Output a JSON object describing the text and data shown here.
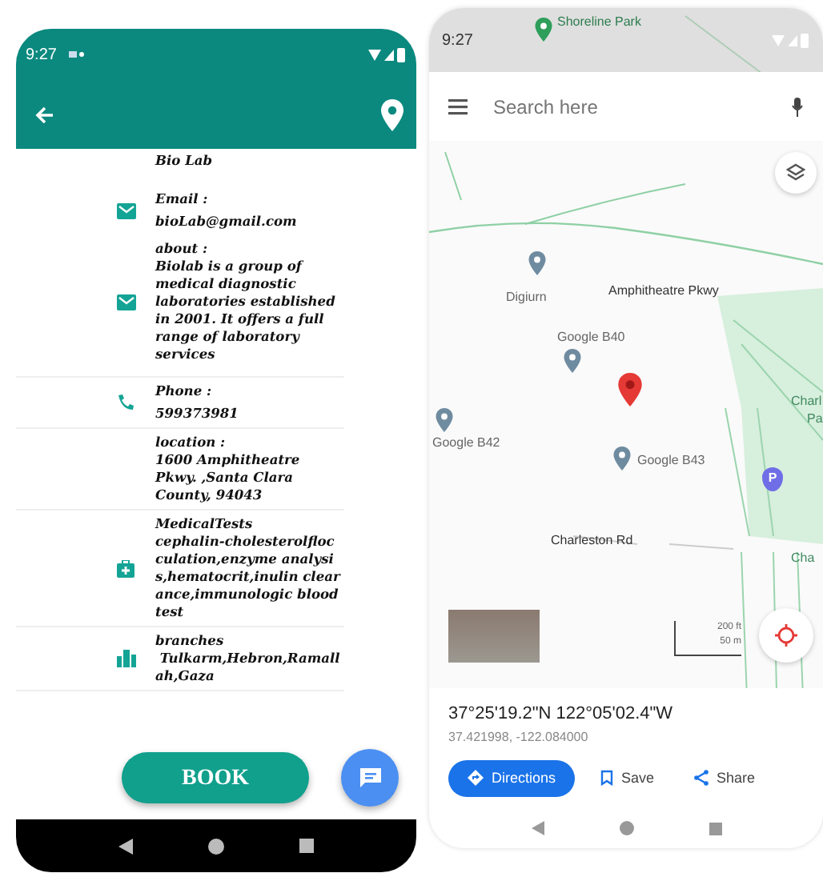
{
  "lab_app": {
    "status_time": "9:27",
    "rows": [
      {
        "kind": "name",
        "label": "Bio Lab"
      },
      {
        "kind": "email",
        "label": "Email :",
        "value": "bioLab@gmail.com"
      },
      {
        "kind": "about",
        "label": "about :",
        "value": "Biolab is a group of medical diagnostic laboratories established in 2001. It offers a full range of laboratory services"
      },
      {
        "kind": "phone",
        "label": "Phone :",
        "value": "599373981"
      },
      {
        "kind": "location",
        "label": "location :",
        "value": "1600 Amphitheatre Pkwy. ,Santa Clara County, 94043"
      },
      {
        "kind": "tests",
        "label": "MedicalTests",
        "value": "cephalin-cholesterolflocculation,enzyme analysis,hematocrit,inulin clearance,immunologic blood test"
      },
      {
        "kind": "branches",
        "label": "branches",
        "value": " Tulkarm,Hebron,Ramallah,Gaza"
      }
    ],
    "book_button": "BOOK"
  },
  "maps_app": {
    "status_time": "9:27",
    "search": {
      "placeholder": "Search here"
    },
    "places": [
      {
        "kind": "park-pin",
        "label": "Shoreline Park"
      },
      {
        "kind": "pin",
        "label": "Digiurn"
      },
      {
        "kind": "road",
        "label": "Amphitheatre Pkwy"
      },
      {
        "kind": "pin",
        "label": "Google B40"
      },
      {
        "kind": "selected-pin"
      },
      {
        "kind": "pin",
        "label": "Google B42"
      },
      {
        "kind": "pin",
        "label": "Google B43"
      },
      {
        "kind": "parking",
        "label": "P"
      },
      {
        "kind": "park-label",
        "label": "Charl"
      },
      {
        "kind": "park-label",
        "label": "Pa"
      },
      {
        "kind": "road",
        "label": "Charleston Rd"
      },
      {
        "kind": "park-label",
        "label": "Cha"
      }
    ],
    "scale": [
      "200 ft",
      "50 m"
    ],
    "coordinates": "37°25'19.2\"N 122°05'02.4\"W",
    "decimal": "37.421998, -122.084000",
    "actions": [
      {
        "kind": "directions",
        "label": "Directions"
      },
      {
        "kind": "save",
        "label": "Save"
      },
      {
        "kind": "share",
        "label": "Share"
      }
    ]
  }
}
